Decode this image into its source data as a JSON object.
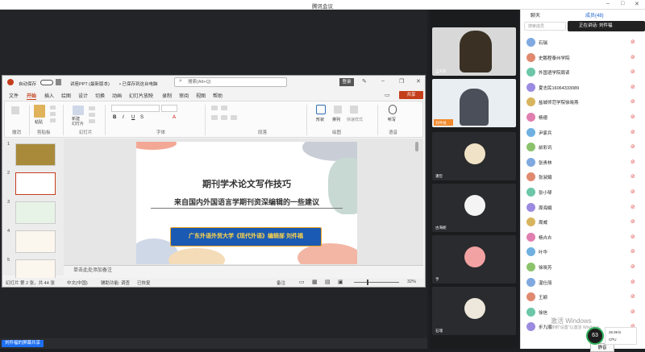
{
  "window": {
    "title": "腾讯会议"
  },
  "ppt": {
    "autosave": "自动保存",
    "doc_title": "讲座PPT (最新版本)",
    "saved_status": "• 已保存到这台电脑",
    "search_placeholder": "搜索(Alt+Q)",
    "login": "登录",
    "tabs": [
      "文件",
      "开始",
      "插入",
      "绘图",
      "设计",
      "切换",
      "动画",
      "幻灯片放映",
      "录制",
      "审阅",
      "视图",
      "帮助"
    ],
    "share": "共享",
    "groups": {
      "undo": "撤消",
      "clipboard": "剪贴板",
      "slides": "幻灯片",
      "font": "字体",
      "paragraph": "段落",
      "drawing": "绘图",
      "voice": "语音"
    },
    "ribbon_labels": {
      "paste": "粘贴",
      "new_slide": "新建\n幻灯片",
      "shape": "形状",
      "arrange": "排列",
      "quick_style": "快速样式",
      "dictate": "听写"
    },
    "thumb_numbers": [
      "1",
      "2",
      "3",
      "4",
      "5"
    ],
    "notes_placeholder": "单击此处添加备注",
    "status": {
      "slide_pos": "幻灯片 第 2 张，共 44 张",
      "lang": "中文(中国)",
      "accessibility": "辅助功能: 调查",
      "recovered": "已恢复",
      "notes": "备注",
      "zoom": "32%"
    },
    "slide": {
      "title": "期刊学术论文写作技巧",
      "subtitle": "来自国内外国语言学期刊资深编辑的一些建议",
      "affiliation": "广东外语外贸大学《现代外语》编辑部    刘件福"
    }
  },
  "share_indicator": "刘件福的屏幕共享",
  "videos": [
    {
      "name": "孟庆新"
    },
    {
      "name": "刘件福"
    },
    {
      "name": "潘哲"
    },
    {
      "name": "古海妮"
    },
    {
      "name": "亨"
    },
    {
      "name": "石瑞"
    }
  ],
  "right_panel": {
    "tab_chat": "聊天",
    "tab_members": "成员(48)",
    "search_placeholder": "搜索成员",
    "speaking": "正在讲话: 刘件福",
    "members": [
      "石瑞",
      "史鹏程泰州学院",
      "外国语学院周读",
      "夏志民16064333089",
      "盐城师范学院徐晓燕",
      "杨德",
      "尹家兵",
      "前彩讯",
      "张贵林",
      "张淑娟",
      "张小琴",
      "周海娟",
      "周威",
      "杨卉卉",
      "叶华",
      "徐晓芳",
      "温仕丽",
      "王颖",
      "徐信",
      "步九顺"
    ],
    "mute_all": "静音",
    "cpu": "63",
    "cpu_label": "CPU",
    "net": "26.9K/s",
    "watermark": "激活 Windows",
    "watermark_sub": "转到\"设置\"以激活 Windows。"
  },
  "colors": {
    "ppt_accent": "#c43e1c",
    "slide_box": "#1a5ab3",
    "speaking_green": "#32b05a"
  }
}
